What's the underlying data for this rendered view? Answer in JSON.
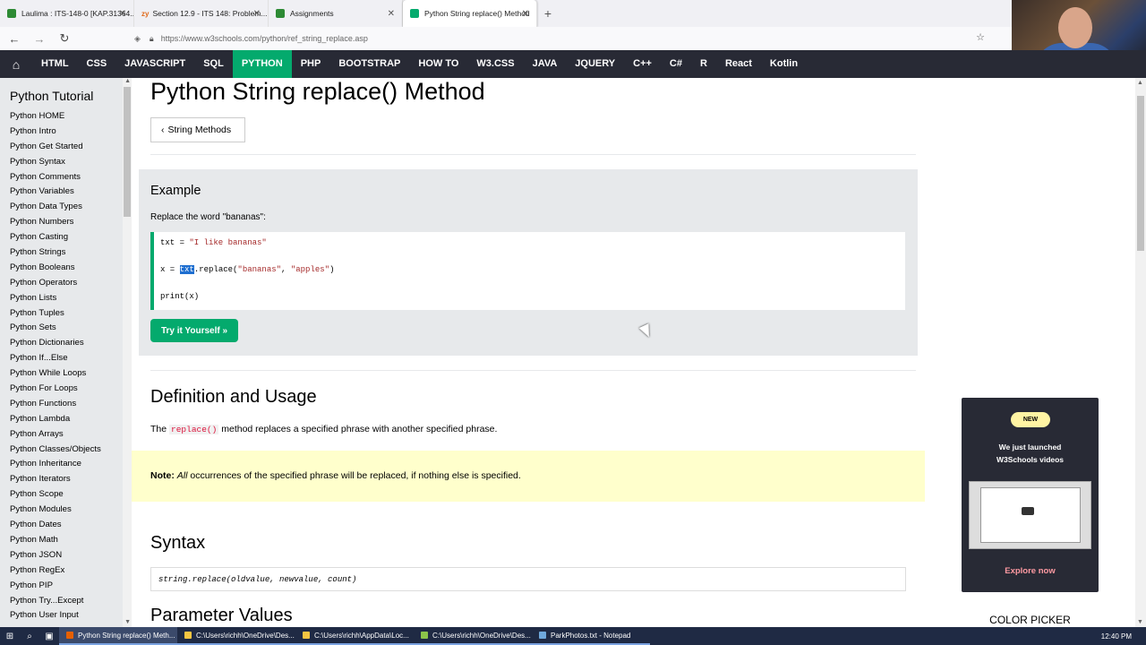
{
  "browser": {
    "tabs": [
      {
        "label": "Laulima : ITS-148-0 [KAP.31364...",
        "color": "#2d8a34"
      },
      {
        "label": "Section 12.9 - ITS 148: Problem...",
        "color": "#e06a1b",
        "prefix": "zy"
      },
      {
        "label": "Assignments",
        "color": "#2d8a34"
      },
      {
        "label": "Python String replace() Method",
        "color": "#04aa6d",
        "active": true
      }
    ],
    "url": "https://www.w3schools.com/python/ref_string_replace.asp",
    "new_tab": "+"
  },
  "topnav": {
    "items": [
      "HTML",
      "CSS",
      "JAVASCRIPT",
      "SQL",
      "PYTHON",
      "PHP",
      "BOOTSTRAP",
      "HOW TO",
      "W3.CSS",
      "JAVA",
      "JQUERY",
      "C++",
      "C#",
      "R",
      "React",
      "Kotlin"
    ],
    "active": "PYTHON"
  },
  "sidebar": {
    "title": "Python Tutorial",
    "links": [
      "Python HOME",
      "Python Intro",
      "Python Get Started",
      "Python Syntax",
      "Python Comments",
      "Python Variables",
      "Python Data Types",
      "Python Numbers",
      "Python Casting",
      "Python Strings",
      "Python Booleans",
      "Python Operators",
      "Python Lists",
      "Python Tuples",
      "Python Sets",
      "Python Dictionaries",
      "Python If...Else",
      "Python While Loops",
      "Python For Loops",
      "Python Functions",
      "Python Lambda",
      "Python Arrays",
      "Python Classes/Objects",
      "Python Inheritance",
      "Python Iterators",
      "Python Scope",
      "Python Modules",
      "Python Dates",
      "Python Math",
      "Python JSON",
      "Python RegEx",
      "Python PIP",
      "Python Try...Except",
      "Python User Input"
    ]
  },
  "main": {
    "title": "Python String replace() Method",
    "back_button": "String Methods",
    "example": {
      "heading": "Example",
      "description": "Replace the word \"bananas\":",
      "code": {
        "line1_var": "txt = ",
        "line1_str": "\"I like bananas\"",
        "line2_a": "x = ",
        "line2_sel": "txt",
        "line2_b": ".replace(",
        "line2_s1": "\"bananas\"",
        "line2_c": ", ",
        "line2_s2": "\"apples\"",
        "line2_d": ")",
        "line3": "print(x)"
      },
      "try_button": "Try it Yourself »"
    },
    "definition": {
      "heading": "Definition and Usage",
      "text_before": "The ",
      "code": "replace()",
      "text_after": " method replaces a specified phrase with another specified phrase."
    },
    "note": {
      "label": "Note:",
      "emph": "All",
      "text": " occurrences of the specified phrase will be replaced, if nothing else is specified."
    },
    "syntax": {
      "heading": "Syntax",
      "code": "string.replace(oldvalue, newvalue, count)"
    },
    "parameters": {
      "heading": "Parameter Values"
    }
  },
  "ad": {
    "badge": "NEW",
    "line1": "We just launched",
    "line2": "W3Schools videos",
    "cta": "Explore now"
  },
  "color_picker": "COLOR PICKER",
  "taskbar": {
    "tasks": [
      {
        "label": "Python String replace() Meth...",
        "color": "#e66000",
        "active": true
      },
      {
        "label": "C:\\Users\\richh\\OneDrive\\Des...",
        "color": "#f5c542"
      },
      {
        "label": "C:\\Users\\richh\\AppData\\Loc...",
        "color": "#f5c542"
      },
      {
        "label": "C:\\Users\\richh\\OneDrive\\Des...",
        "color": "#8bc34a"
      },
      {
        "label": "ParkPhotos.txt - Notepad",
        "color": "#6fa8dc"
      }
    ],
    "clock": "12:40 PM"
  },
  "colors": {
    "accent": "#04aa6d",
    "nav_bg": "#282a35",
    "note_bg": "#ffffcc",
    "sidebar_bg": "#e7e9eb"
  }
}
